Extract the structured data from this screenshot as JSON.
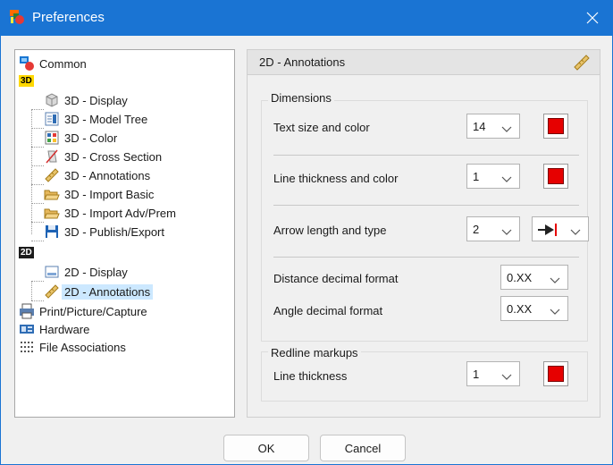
{
  "window": {
    "title": "Preferences",
    "close_glyph": "✕"
  },
  "tree": {
    "items": [
      {
        "label": "Common",
        "icon": "common-icon"
      },
      {
        "label": "3D",
        "icon": "3d-badge"
      },
      {
        "label": "3D - Display",
        "icon": "display-cube-icon"
      },
      {
        "label": "3D - Model Tree",
        "icon": "model-tree-icon"
      },
      {
        "label": "3D - Color",
        "icon": "color-grid-icon"
      },
      {
        "label": "3D - Cross Section",
        "icon": "cross-section-icon"
      },
      {
        "label": "3D - Annotations",
        "icon": "ruler-icon"
      },
      {
        "label": "3D - Import Basic",
        "icon": "folder-open-icon"
      },
      {
        "label": "3D - Import Adv/Prem",
        "icon": "folder-open-icon"
      },
      {
        "label": "3D - Publish/Export",
        "icon": "save-disk-icon"
      },
      {
        "label": "2D",
        "icon": "2d-badge"
      },
      {
        "label": "2D - Display",
        "icon": "display-2d-icon"
      },
      {
        "label": "2D - Annotations",
        "icon": "ruler-icon",
        "selected": true
      },
      {
        "label": "Print/Picture/Capture",
        "icon": "print-icon"
      },
      {
        "label": "Hardware",
        "icon": "hardware-icon"
      },
      {
        "label": "File Associations",
        "icon": "file-associations-icon"
      }
    ]
  },
  "panel": {
    "title": "2D - Annotations",
    "dimensions": {
      "group_label": "Dimensions",
      "text_size_label": "Text size and color",
      "text_size_value": "14",
      "text_color": "#e60000",
      "line_thickness_label": "Line thickness and color",
      "line_thickness_value": "1",
      "line_color": "#e60000",
      "arrow_label": "Arrow length and type",
      "arrow_length_value": "2",
      "arrow_type_icon": "arrow-head-icon",
      "distance_label": "Distance decimal format",
      "distance_value": "0.XX",
      "angle_label": "Angle decimal format",
      "angle_value": "0.XX"
    },
    "redline": {
      "group_label": "Redline markups",
      "line_thickness_label": "Line thickness",
      "line_thickness_value": "1",
      "line_color": "#e60000"
    }
  },
  "buttons": {
    "ok": "OK",
    "cancel": "Cancel"
  },
  "colors": {
    "titlebar": "#1a74d3",
    "selection": "#cce8ff",
    "swatch_red": "#e60000"
  }
}
